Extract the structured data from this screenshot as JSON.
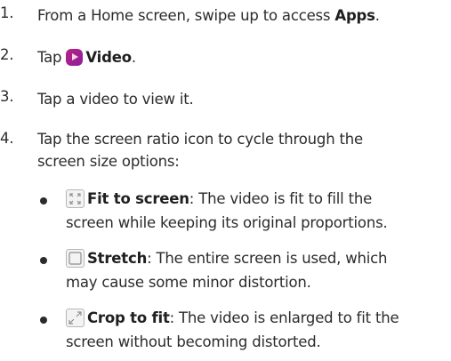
{
  "steps": [
    {
      "num": "1.",
      "pre": "From a Home screen, swipe up to access ",
      "bold": "Apps",
      "post": "."
    },
    {
      "num": "2.",
      "pre": "Tap ",
      "icon": "video-app-icon",
      "bold": "Video",
      "post": "."
    },
    {
      "num": "3.",
      "text": "Tap a video to view it."
    },
    {
      "num": "4.",
      "line1": "Tap the screen ratio icon to cycle through the",
      "line2": "screen size options:"
    }
  ],
  "options": [
    {
      "icon": "fit-to-screen-icon",
      "title": "Fit to screen",
      "rest": ": The video is fit to fill the",
      "line2": "screen while keeping its original proportions."
    },
    {
      "icon": "stretch-icon",
      "title": "Stretch",
      "rest": ": The entire screen is used, which",
      "line2": "may cause some minor distortion."
    },
    {
      "icon": "crop-to-fit-icon",
      "title": "Crop to fit",
      "rest": ": The video is enlarged to fit the",
      "line2": "screen without becoming distorted."
    }
  ]
}
